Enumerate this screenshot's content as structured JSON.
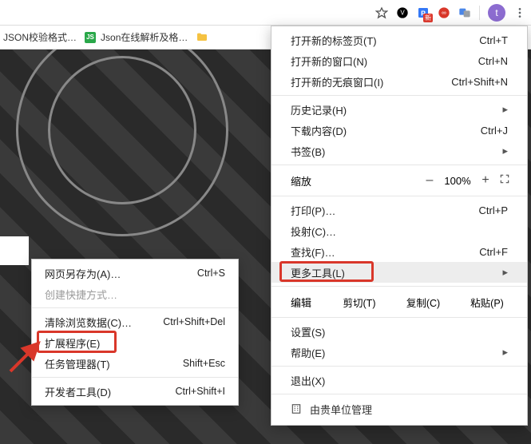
{
  "toolbar": {
    "icons": [
      "star-icon",
      "v-badge-icon",
      "p-badge-icon",
      "infinity-icon",
      "translate-icon",
      "avatar-t",
      "kebab-icon"
    ],
    "avatar_letter": "t"
  },
  "bookmarks": {
    "items": [
      {
        "label": "JSON校验格式…"
      },
      {
        "label": "Json在线解析及格…"
      }
    ],
    "folder_icon": "folder"
  },
  "menu": {
    "new_tab": {
      "label": "打开新的标签页(T)",
      "shortcut": "Ctrl+T"
    },
    "new_window": {
      "label": "打开新的窗口(N)",
      "shortcut": "Ctrl+N"
    },
    "incognito": {
      "label": "打开新的无痕窗口(I)",
      "shortcut": "Ctrl+Shift+N"
    },
    "history": {
      "label": "历史记录(H)"
    },
    "downloads": {
      "label": "下载内容(D)",
      "shortcut": "Ctrl+J"
    },
    "bookmarks": {
      "label": "书签(B)"
    },
    "zoom": {
      "label": "缩放",
      "minus": "–",
      "pct": "100%",
      "plus": "+"
    },
    "print": {
      "label": "打印(P)…",
      "shortcut": "Ctrl+P"
    },
    "cast": {
      "label": "投射(C)…"
    },
    "find": {
      "label": "查找(F)…",
      "shortcut": "Ctrl+F"
    },
    "more_tools": {
      "label": "更多工具(L)"
    },
    "edit": {
      "label": "编辑",
      "cut": "剪切(T)",
      "copy": "复制(C)",
      "paste": "粘贴(P)"
    },
    "settings": {
      "label": "设置(S)"
    },
    "help": {
      "label": "帮助(E)"
    },
    "exit": {
      "label": "退出(X)"
    },
    "managed": {
      "label": "由贵单位管理"
    }
  },
  "submenu": {
    "save_as": {
      "label": "网页另存为(A)…",
      "shortcut": "Ctrl+S"
    },
    "create_sc": {
      "label": "创建快捷方式…"
    },
    "clear_data": {
      "label": "清除浏览数据(C)…",
      "shortcut": "Ctrl+Shift+Del"
    },
    "extensions": {
      "label": "扩展程序(E)"
    },
    "taskmgr": {
      "label": "任务管理器(T)",
      "shortcut": "Shift+Esc"
    },
    "devtools": {
      "label": "开发者工具(D)",
      "shortcut": "Ctrl+Shift+I"
    }
  }
}
